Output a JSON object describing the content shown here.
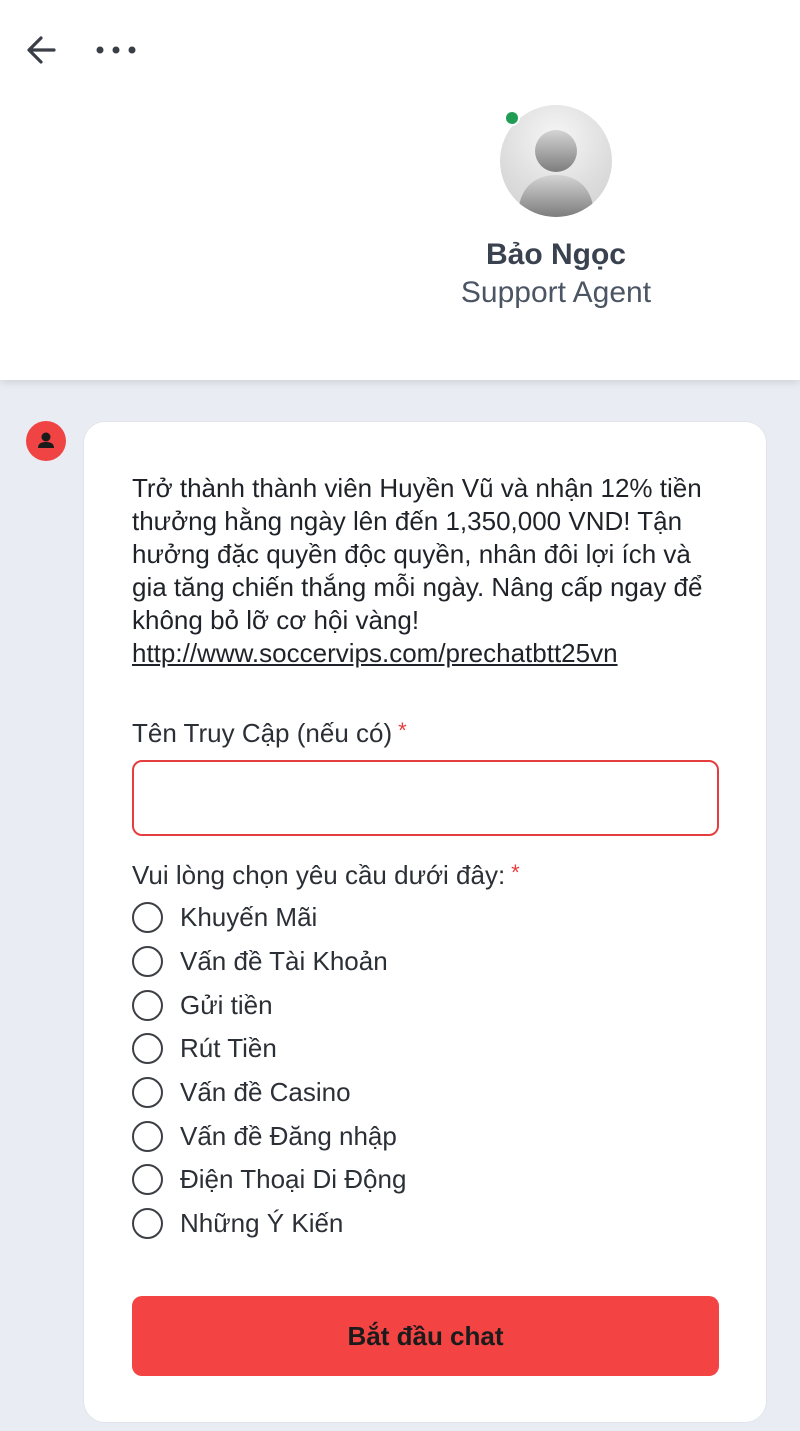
{
  "header": {
    "back_icon": "arrow-left-icon",
    "more_icon": "more-horizontal-icon",
    "agent": {
      "name": "Bảo Ngọc",
      "role": "Support Agent",
      "status_color": "#1f9d55"
    }
  },
  "message": {
    "text": "Trở thành thành viên Huyền Vũ và nhận 12% tiền thưởng hằng ngày lên đến 1,350,000 VND! Tận hưởng đặc quyền độc quyền, nhân đôi lợi ích và gia tăng chiến thắng mỗi ngày. Nâng cấp ngay để không bỏ lỡ cơ hội vàng!",
    "link": "http://www.soccervips.com/prechatbtt25vn"
  },
  "form": {
    "username_label": "Tên Truy Cập (nếu có)",
    "required_mark": "*",
    "username_value": "",
    "request_label": "Vui lòng chọn yêu cầu dưới đây:",
    "options": [
      "Khuyến Mãi",
      "Vấn đề Tài Khoản",
      "Gửi tiền",
      "Rút Tiền",
      "Vấn đề Casino",
      "Vấn đề Đăng nhập",
      "Điện Thoại Di Động",
      "Những Ý Kiến"
    ],
    "submit_label": "Bắt đầu chat"
  },
  "colors": {
    "accent": "#f34343",
    "background": "#e9edf3"
  }
}
